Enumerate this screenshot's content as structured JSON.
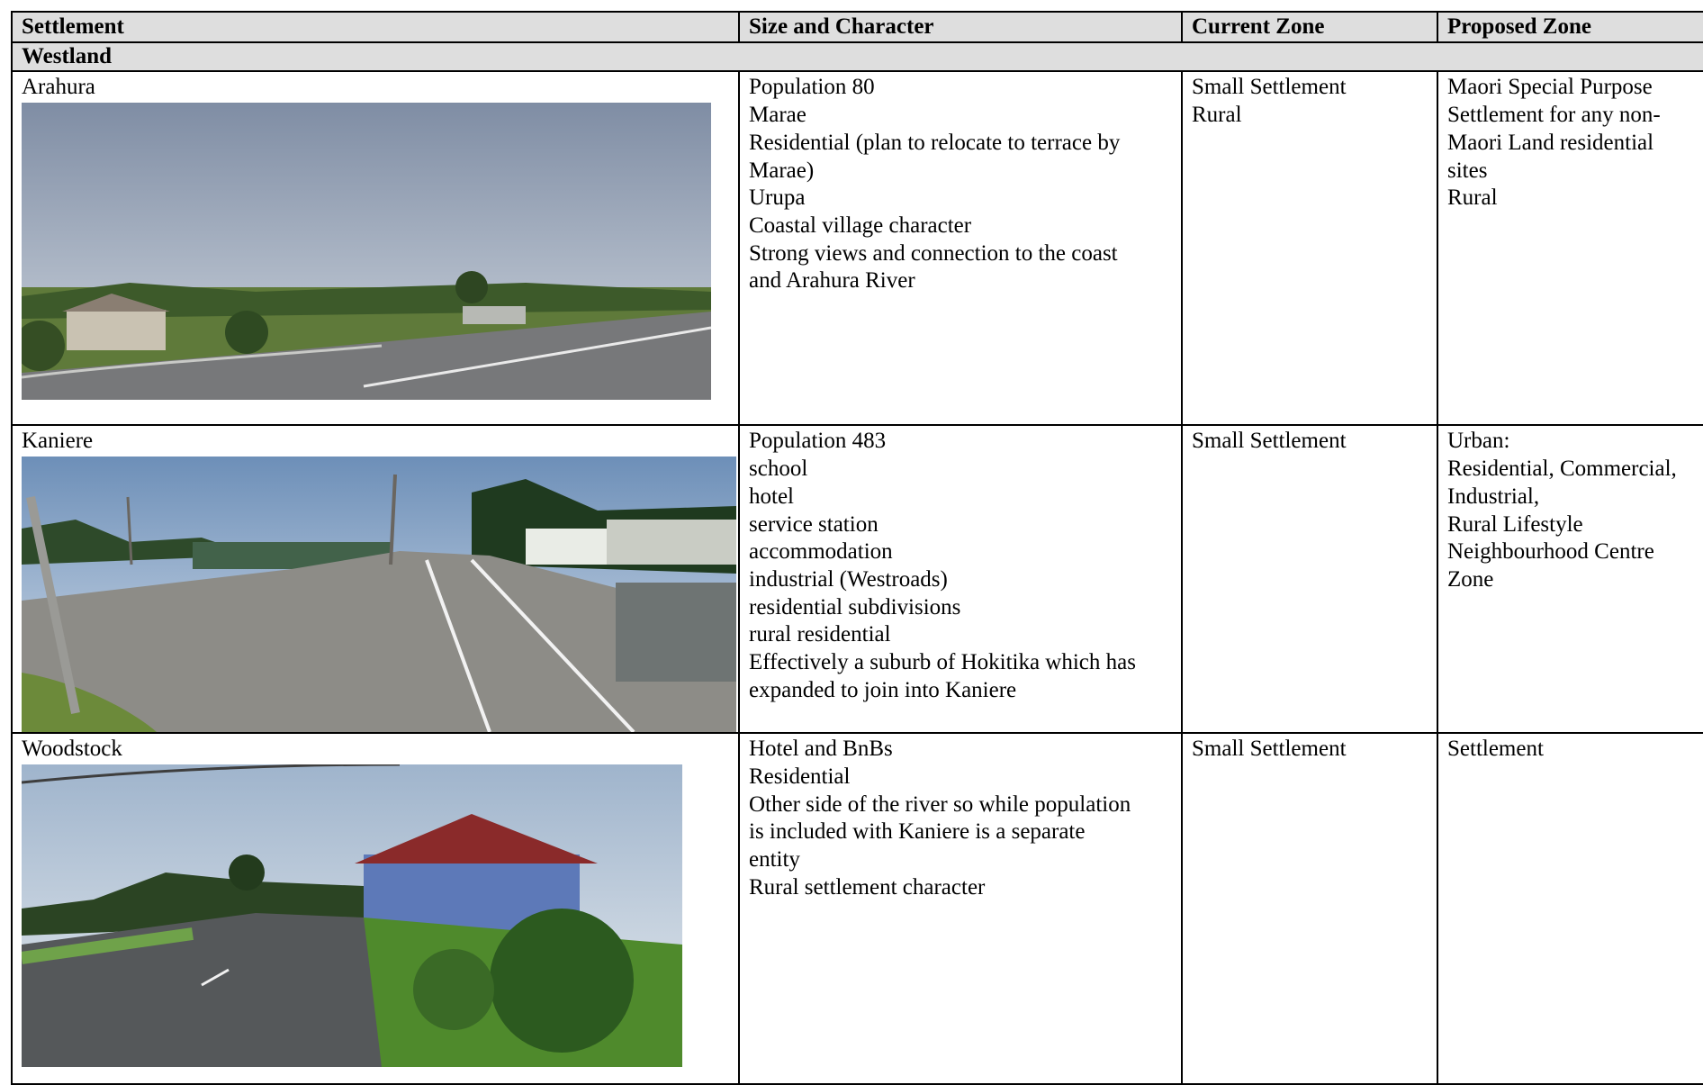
{
  "table": {
    "headers": [
      "Settlement",
      "Size and Character",
      "Current Zone",
      "Proposed Zone"
    ],
    "section": "Westland",
    "rows": [
      {
        "settlement": "Arahura",
        "size_lines": [
          "Population 80",
          "Marae",
          "Residential (plan to relocate to terrace by",
          "Marae)",
          "Urupa",
          "Coastal village character",
          "Strong views and connection to the coast",
          "and Arahura River"
        ],
        "current_lines": [
          "Small Settlement",
          "Rural"
        ],
        "proposed_lines": [
          "Maori Special Purpose",
          "Settlement for any non-",
          "Maori Land residential",
          "sites",
          "Rural"
        ]
      },
      {
        "settlement": "Kaniere",
        "size_lines": [
          "Population 483",
          "school",
          "hotel",
          "service station",
          "accommodation",
          "industrial (Westroads)",
          "residential subdivisions",
          "rural residential",
          "Effectively a suburb of Hokitika which has",
          "expanded to join into Kaniere"
        ],
        "current_lines": [
          "Small Settlement"
        ],
        "proposed_lines": [
          "Urban:",
          "Residential, Commercial,",
          "Industrial,",
          "Rural Lifestyle",
          "Neighbourhood Centre",
          "Zone"
        ]
      },
      {
        "settlement": "Woodstock",
        "size_lines": [
          "Hotel and BnBs",
          "Residential",
          "Other side of the river so while population",
          "is included with Kaniere is a separate",
          "entity",
          "Rural settlement character"
        ],
        "current_lines": [
          "Small Settlement"
        ],
        "proposed_lines": [
          "Settlement"
        ]
      }
    ]
  }
}
